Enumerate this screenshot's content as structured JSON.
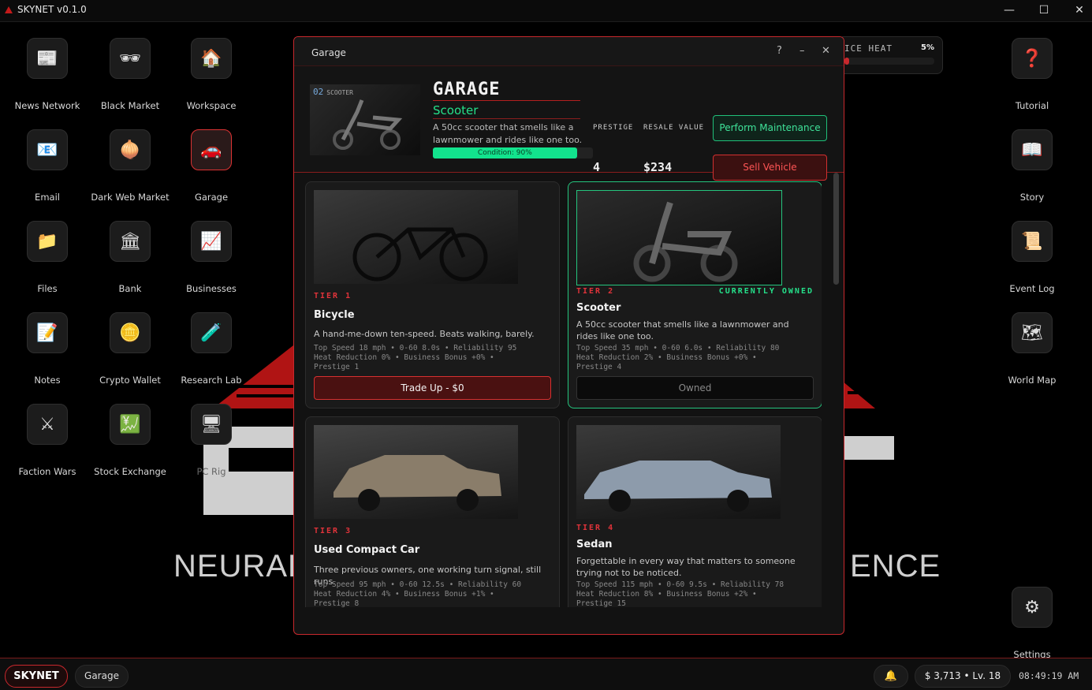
{
  "app": {
    "title": "SKYNET v0.1.0"
  },
  "window_controls": {
    "minimize": "—",
    "maximize": "☐",
    "close": "✕"
  },
  "wallpaper": {
    "text_left": "NEURAL",
    "text_right": "ENCE"
  },
  "desktop_left": [
    {
      "label": "News Network",
      "icon": "📰",
      "icon_name": "newspaper-icon"
    },
    {
      "label": "Black Market",
      "icon": "🕶",
      "icon_name": "sunglasses-icon"
    },
    {
      "label": "Workspace",
      "icon": "🏠",
      "icon_name": "house-icon"
    },
    {
      "label": "Email",
      "icon": "📧",
      "icon_name": "email-icon"
    },
    {
      "label": "Dark Web Market",
      "icon": "🧅",
      "icon_name": "onion-icon"
    },
    {
      "label": "Garage",
      "icon": "🚗",
      "icon_name": "car-icon"
    },
    {
      "label": "Files",
      "icon": "📁",
      "icon_name": "folder-icon"
    },
    {
      "label": "Bank",
      "icon": "🏛",
      "icon_name": "bank-icon"
    },
    {
      "label": "Businesses",
      "icon": "📈",
      "icon_name": "chart-icon"
    },
    {
      "label": "Notes",
      "icon": "📝",
      "icon_name": "notes-icon"
    },
    {
      "label": "Crypto Wallet",
      "icon": "🪙",
      "icon_name": "coin-icon"
    },
    {
      "label": "Research Lab",
      "icon": "🧪",
      "icon_name": "test-tube-icon"
    },
    {
      "label": "Faction Wars",
      "icon": "⚔",
      "icon_name": "swords-icon"
    },
    {
      "label": "Stock Exchange",
      "icon": "💹",
      "icon_name": "stock-icon"
    },
    {
      "label": "PC Rig",
      "icon": "🖥",
      "icon_name": "computer-icon"
    }
  ],
  "desktop_right": [
    {
      "label": "Tutorial",
      "icon": "❓",
      "icon_name": "question-icon"
    },
    {
      "label": "Story",
      "icon": "📖",
      "icon_name": "book-icon"
    },
    {
      "label": "Event Log",
      "icon": "📜",
      "icon_name": "scroll-icon"
    },
    {
      "label": "World Map",
      "icon": "🗺",
      "icon_name": "map-icon"
    },
    {
      "label": "Settings",
      "icon": "⚙",
      "icon_name": "gear-icon"
    }
  ],
  "heat": {
    "label": "ICE HEAT",
    "value": "5%",
    "level": 0.05
  },
  "window": {
    "title": "Garage",
    "help": "?",
    "minimize": "–",
    "close": "✕",
    "hero": {
      "badge_num": "02",
      "badge_text": "SCOOTER",
      "heading": "GARAGE",
      "vehicle": "Scooter",
      "desc": "A 50cc scooter that smells like a lawnmower and rides like one too.",
      "condition_label": "Condition: 90%",
      "condition": 0.9,
      "prestige_label": "PRESTIGE",
      "prestige": "4",
      "resale_label": "RESALE VALUE",
      "resale": "$234",
      "maint_button": "Perform Maintenance",
      "sell_button": "Sell Vehicle"
    },
    "cards": [
      {
        "tier": "TIER 1",
        "name": "Bicycle",
        "desc": "A hand-me-down ten-speed. Beats walking, barely.",
        "specs1": "Top Speed 18 mph  •  0-60 8.0s  •  Reliability 95",
        "specs2": "Heat Reduction 0%  •  Business Bonus +0%  •",
        "specs3": "Prestige 1",
        "action": "Trade Up - $0",
        "owned_tag": ""
      },
      {
        "tier": "TIER 2",
        "name": "Scooter",
        "desc": "A 50cc scooter that smells like a lawnmower and rides like one too.",
        "specs1": "Top Speed 35 mph  •  0-60 6.0s  •  Reliability 80",
        "specs2": "Heat Reduction 2%  •  Business Bonus +0%  •",
        "specs3": "Prestige 4",
        "action": "Owned",
        "owned_tag": "CURRENTLY OWNED"
      },
      {
        "tier": "TIER 3",
        "name": "Used Compact Car",
        "desc": "Three previous owners, one working turn signal, still runs.",
        "specs1": "Top Speed 95 mph  •  0-60 12.5s  •  Reliability 60",
        "specs2": "Heat Reduction 4%  •  Business Bonus +1%  •",
        "specs3": "Prestige 8",
        "action": "",
        "owned_tag": ""
      },
      {
        "tier": "TIER 4",
        "name": "Sedan",
        "desc": "Forgettable in every way that matters to someone trying not to be noticed.",
        "specs1": "Top Speed 115 mph  •  0-60 9.5s  •  Reliability 78",
        "specs2": "Heat Reduction 8%  •  Business Bonus +2%  •",
        "specs3": "Prestige 15",
        "action": "",
        "owned_tag": ""
      }
    ]
  },
  "taskbar": {
    "start": "SKYNET",
    "app": "Garage",
    "bell": "🔔",
    "money": "$ 3,713  •  Lv. 18",
    "clock": "08:49:19 AM"
  },
  "colors": {
    "accent_red": "#c8282d",
    "accent_green": "#25e08a"
  }
}
